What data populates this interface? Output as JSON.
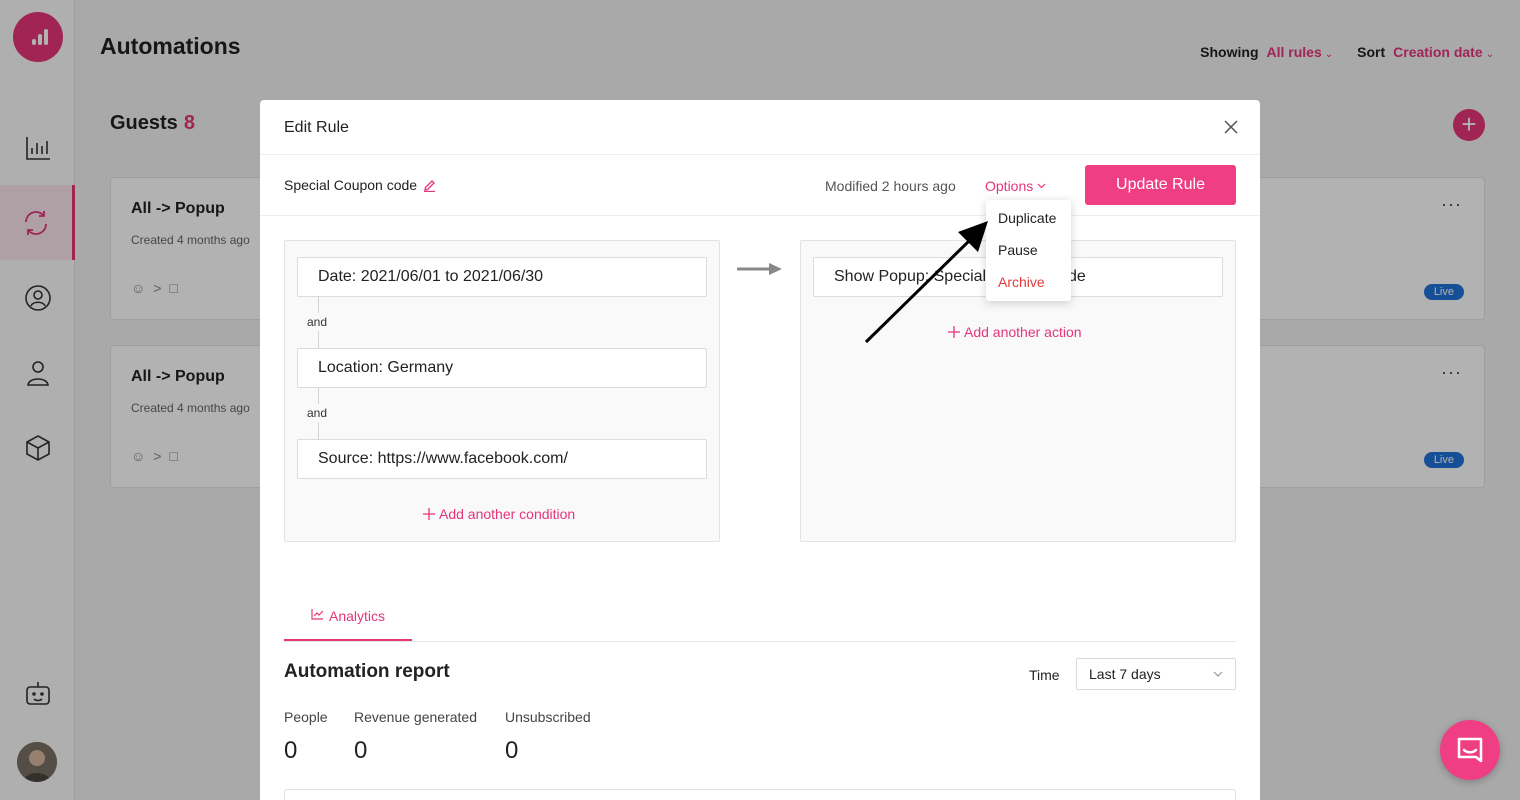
{
  "app": {
    "title": "Automations",
    "showing_label": "Showing",
    "showing_value": "All rules",
    "sort_label": "Sort",
    "sort_value": "Creation date",
    "accent_color": "#e6357a"
  },
  "sidebar": {
    "items": [
      {
        "icon": "analytics-icon"
      },
      {
        "icon": "automation-icon",
        "active": true
      },
      {
        "icon": "contacts-icon"
      },
      {
        "icon": "user-icon"
      },
      {
        "icon": "package-icon"
      },
      {
        "icon": "bot-icon"
      }
    ]
  },
  "guests": {
    "label": "Guests",
    "count": "8"
  },
  "rules": [
    {
      "title": "All -> Popup",
      "created": "Created 4 months ago",
      "status": "Live"
    },
    {
      "title": "All -> Popup",
      "created": "Created 4 months ago",
      "status": "Live"
    }
  ],
  "modal": {
    "title": "Edit Rule",
    "rule_name": "Special Coupon code",
    "modified": "Modified 2 hours ago",
    "options_label": "Options",
    "update_button": "Update Rule",
    "conditions": [
      "Date: 2021/06/01 to 2021/06/30",
      "Location: Germany",
      "Source: https://www.facebook.com/"
    ],
    "and_label": "and",
    "add_condition": "Add another condition",
    "action_text": "Show Popup: Special Coupon code",
    "add_action": "Add another action",
    "options_menu": [
      "Duplicate",
      "Pause",
      "Archive"
    ],
    "tab_label": "Analytics",
    "report_title": "Automation report",
    "time_label": "Time",
    "time_value": "Last 7 days",
    "metrics": [
      {
        "label": "People",
        "value": "0"
      },
      {
        "label": "Revenue generated",
        "value": "0"
      },
      {
        "label": "Unsubscribed",
        "value": "0"
      }
    ]
  }
}
